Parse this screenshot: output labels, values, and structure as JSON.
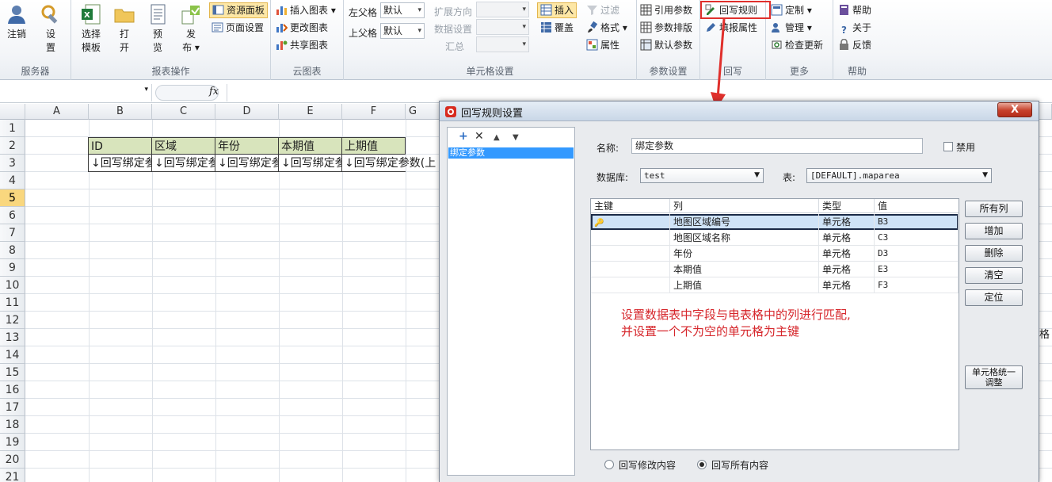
{
  "ribbon": {
    "groups": [
      {
        "label": "服务器",
        "buttons": [
          "注销",
          "设置"
        ]
      },
      {
        "label": "报表操作",
        "buttons": [
          "选择模板",
          "打开",
          "预览",
          "发布"
        ]
      },
      {
        "label": "云图表",
        "buttons": [
          "插入图表",
          "更改图表",
          "共享图表"
        ]
      },
      {
        "label": "单元格设置"
      },
      {
        "label": "参数设置",
        "buttons": [
          "引用参数",
          "参数排版",
          "默认参数"
        ]
      },
      {
        "label": "回写",
        "buttons": [
          "回写规则",
          "填报属性"
        ]
      },
      {
        "label": "更多",
        "buttons": [
          "定制",
          "管理",
          "检查更新"
        ]
      },
      {
        "label": "帮助",
        "buttons": [
          "帮助",
          "关于",
          "反馈"
        ]
      }
    ],
    "server": {
      "logout": "注销",
      "settings": "设置"
    },
    "report": {
      "select_template": "选择模板",
      "open": "打开",
      "preview": "预览",
      "publish": "发布",
      "resource_panel": "资源面板",
      "page_setup": "页面设置"
    },
    "cloudchart": {
      "insert": "插入图表",
      "change": "更改图表",
      "share": "共享图表"
    },
    "cellsettings": {
      "left_parent_label": "左父格",
      "left_parent_value": "默认",
      "top_parent_label": "上父格",
      "top_parent_value": "默认",
      "expand_dir": "扩展方向",
      "data_settings": "数据设置",
      "summary": "汇总",
      "insert": "插入",
      "overwrite": "覆盖",
      "filter": "过滤",
      "format": "格式",
      "property": "属性"
    },
    "params": {
      "ref": "引用参数",
      "layout": "参数排版",
      "default": "默认参数"
    },
    "writeback": {
      "rule": "回写规则",
      "fill_prop": "填报属性"
    },
    "more": {
      "custom": "定制",
      "manage": "管理",
      "check_update": "检查更新"
    },
    "help": {
      "help": "帮助",
      "about": "关于",
      "feedback": "反馈"
    }
  },
  "formula_bar": {
    "fx": "fx"
  },
  "sheet": {
    "columns": [
      "A",
      "B",
      "C",
      "D",
      "E",
      "F",
      "G"
    ],
    "rows": [
      "1",
      "2",
      "3",
      "4",
      "5",
      "6",
      "7",
      "8",
      "9",
      "10",
      "11",
      "12",
      "13",
      "14",
      "15",
      "16",
      "17",
      "18",
      "19",
      "20",
      "21"
    ],
    "selected_row": "5",
    "headers": [
      "ID",
      "区域",
      "年份",
      "本期值",
      "上期值"
    ],
    "values": [
      "↓回写绑定参",
      "↓回写绑定参",
      "↓回写绑定参",
      "↓回写绑定参",
      "↓回写绑定参数(上"
    ],
    "clipped_right": "格"
  },
  "dialog": {
    "title": "回写规则设置",
    "close": "X",
    "list": [
      "绑定参数"
    ],
    "name_label": "名称:",
    "name_value": "绑定参数",
    "disable_label": "禁用",
    "db_label": "数据库:",
    "db_value": "test",
    "table_label": "表:",
    "table_value": "[DEFAULT].maparea",
    "table_headers": [
      "主键",
      "列",
      "类型",
      "值"
    ],
    "table_rows": [
      {
        "key": true,
        "col": "地图区域编号",
        "type": "单元格",
        "val": "B3"
      },
      {
        "key": false,
        "col": "地图区域名称",
        "type": "单元格",
        "val": "C3"
      },
      {
        "key": false,
        "col": "年份",
        "type": "单元格",
        "val": "D3"
      },
      {
        "key": false,
        "col": "本期值",
        "type": "单元格",
        "val": "E3"
      },
      {
        "key": false,
        "col": "上期值",
        "type": "单元格",
        "val": "F3"
      }
    ],
    "note_line1": "设置数据表中字段与电表格中的列进行匹配,",
    "note_line2": "并设置一个不为空的单元格为主键",
    "buttons": {
      "all_cols": "所有列",
      "add": "增加",
      "delete": "删除",
      "clear": "清空",
      "locate": "定位",
      "unify_l1": "单元格统一",
      "unify_l2": "调整"
    },
    "radio_modified": "回写修改内容",
    "radio_all": "回写所有内容",
    "radio_selected": "all"
  },
  "colors": {
    "accent_red": "#e0302c",
    "header_fill": "#d8e4bc",
    "selection": "#cfe3f7"
  }
}
